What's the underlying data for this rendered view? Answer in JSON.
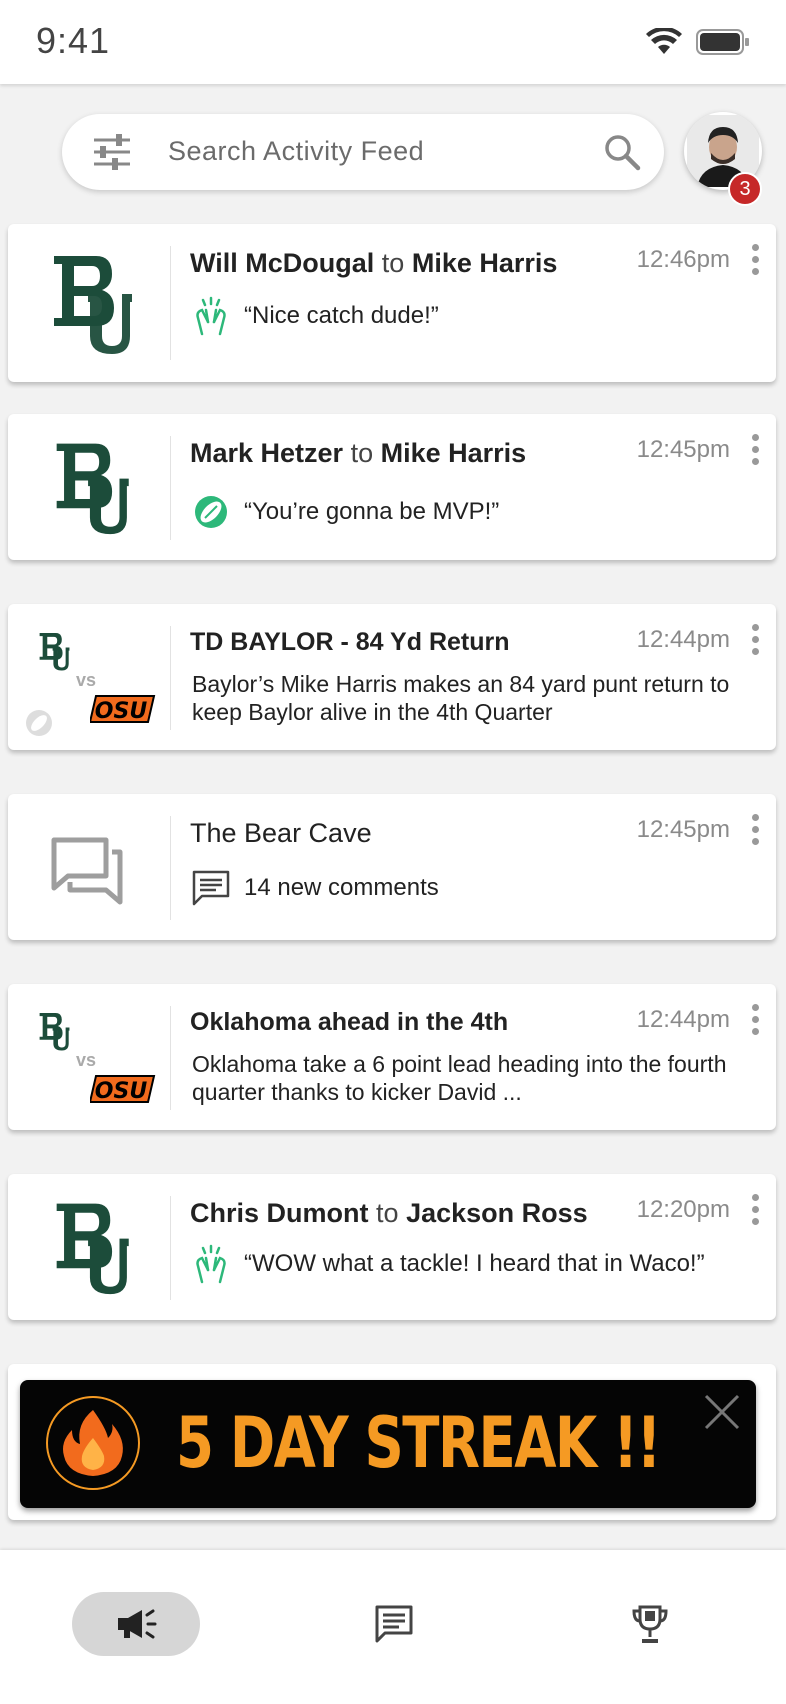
{
  "status": {
    "time": "9:41"
  },
  "search": {
    "placeholder": "Search Activity Feed"
  },
  "profile": {
    "badge_count": "3"
  },
  "feed": [
    {
      "sender": "Will McDougal",
      "connector": "to",
      "recipient": "Mike Harris",
      "time": "12:46pm",
      "icon": "high-five-icon",
      "message": "“Nice catch dude!”"
    },
    {
      "sender": "Mark Hetzer",
      "connector": "to",
      "recipient": "Mike Harris",
      "time": "12:45pm",
      "icon": "football-icon",
      "message": "“You’re gonna be MVP!”"
    },
    {
      "title": "TD BAYLOR - 84 Yd Return",
      "time": "12:44pm",
      "body": "Baylor’s Mike Harris makes an 84 yard punt return to keep Baylor alive in the 4th Quarter",
      "vs": "vs"
    },
    {
      "title": "The Bear Cave",
      "time": "12:45pm",
      "icon": "comment-icon",
      "message": "14 new comments"
    },
    {
      "title": "Oklahoma ahead in the 4th",
      "time": "12:44pm",
      "body": "Oklahoma take a 6 point lead heading into the fourth quarter thanks to kicker David ...",
      "vs": "vs"
    },
    {
      "sender": "Chris Dumont",
      "connector": "to",
      "recipient": "Jackson Ross",
      "time": "12:20pm",
      "icon": "high-five-icon",
      "message": "“WOW what a tackle! I heard that in Waco!”"
    }
  ],
  "streak": {
    "text": "5 DAY STREAK !!"
  },
  "nav": {
    "items": [
      "activity-feed",
      "messages",
      "leaderboard"
    ]
  },
  "colors": {
    "baylor_green": "#1c4c3a",
    "accent_green": "#2db87a",
    "streak_orange": "#f59a23",
    "badge_red": "#c62828"
  }
}
